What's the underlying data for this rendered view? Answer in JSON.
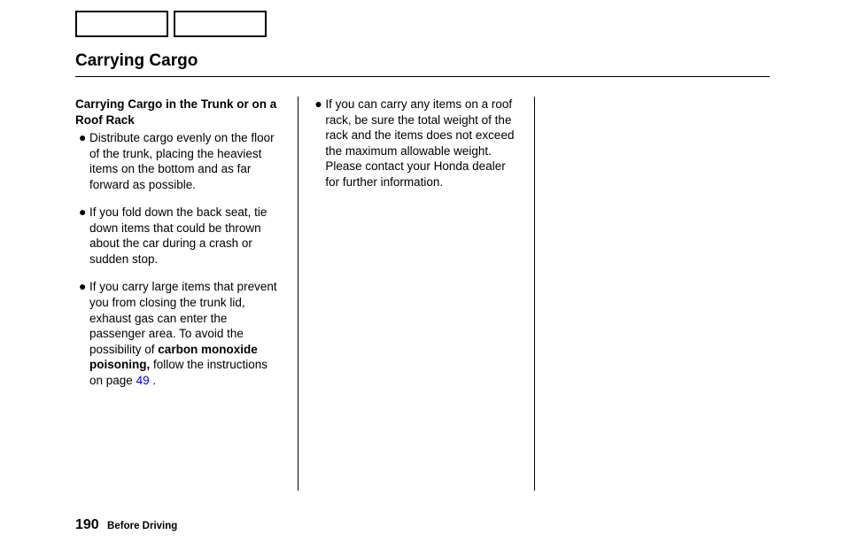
{
  "title": "Carrying Cargo",
  "subheading": "Carrying Cargo in the Trunk or on a Roof Rack",
  "col1": {
    "b1": "Distribute cargo evenly on the floor of the trunk, placing the heaviest items on the bottom and as far forward as possible.",
    "b2": "If you fold down the back seat, tie down items that could be thrown about the car during a crash or sudden stop.",
    "b3_pre": "If you carry large items that prevent you from closing the trunk lid, exhaust gas can enter the passenger area. To avoid the possibility of ",
    "b3_bold": "carbon monoxide poisoning,",
    "b3_post": " follow the instructions on page  ",
    "b3_link": "49",
    "b3_end": " ."
  },
  "col2": {
    "b1": "If you can carry any items on a roof rack, be sure the total weight of the rack and the items does not exceed the maximum allowable weight. Please contact your Honda dealer for further information."
  },
  "footer": {
    "page": "190",
    "section": "Before Driving"
  }
}
